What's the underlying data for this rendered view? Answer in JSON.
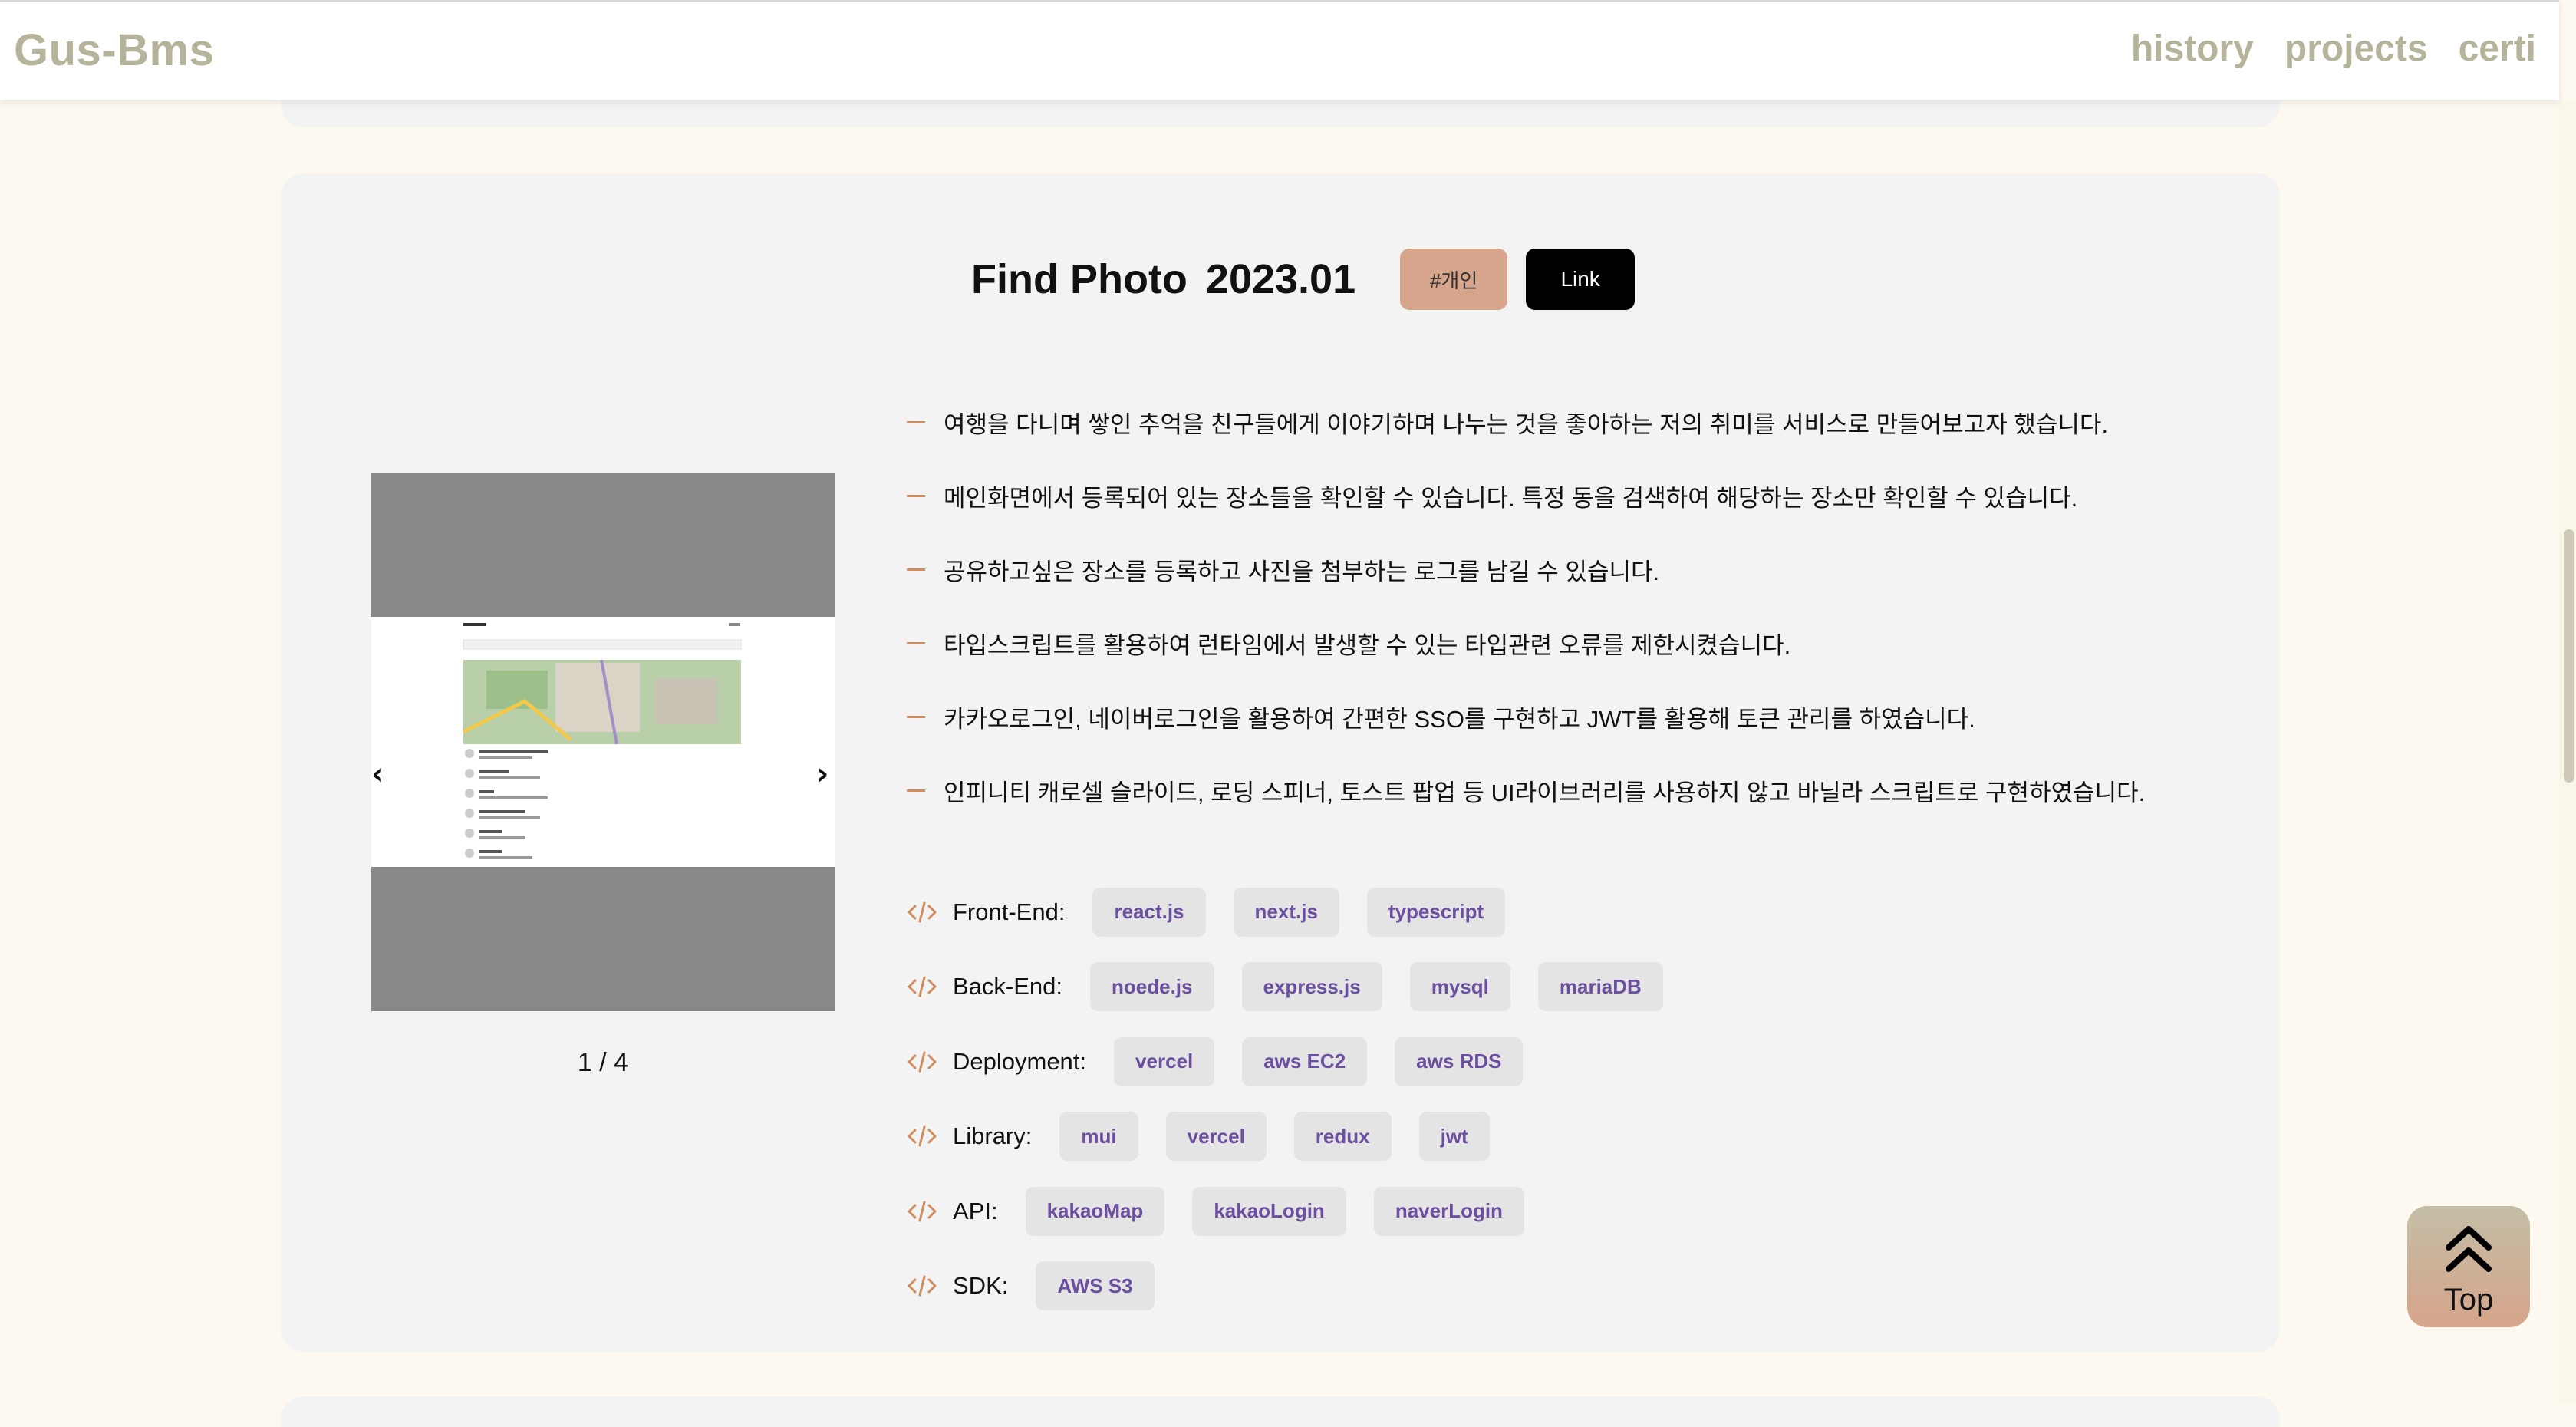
{
  "header": {
    "logo": "Gus-Bms",
    "nav": [
      "history",
      "projects",
      "certi"
    ]
  },
  "project": {
    "title": "Find Photo",
    "date": "2023.01",
    "tag": "#개인",
    "link_label": "Link",
    "carousel": {
      "counter": "1 / 4",
      "prev_arrow": "‹",
      "next_arrow": "›"
    },
    "descriptions": [
      "여행을 다니며 쌓인 추억을 친구들에게 이야기하며 나누는 것을 좋아하는 저의 취미를 서비스로 만들어보고자 했습니다.",
      "메인화면에서 등록되어 있는 장소들을 확인할 수 있습니다. 특정 동을 검색하여 해당하는 장소만 확인할 수 있습니다.",
      "공유하고싶은 장소를 등록하고 사진을 첨부하는 로그를 남길 수 있습니다.",
      "타입스크립트를 활용하여 런타임에서 발생할 수 있는 타입관련 오류를 제한시켰습니다.",
      "카카오로그인, 네이버로그인을 활용하여 간편한 SSO를 구현하고 JWT를 활용해 토큰 관리를 하였습니다.",
      "인피니티 캐로셀 슬라이드, 로딩 스피너, 토스트 팝업 등 UI라이브러리를 사용하지 않고 바닐라 스크립트로 구현하였습니다."
    ],
    "stacks": [
      {
        "label": "Front-End:",
        "items": [
          "react.js",
          "next.js",
          "typescript"
        ]
      },
      {
        "label": "Back-End:",
        "items": [
          "noede.js",
          "express.js",
          "mysql",
          "mariaDB"
        ]
      },
      {
        "label": "Deployment:",
        "items": [
          "vercel",
          "aws EC2",
          "aws RDS"
        ]
      },
      {
        "label": "Library:",
        "items": [
          "mui",
          "vercel",
          "redux",
          "jwt"
        ]
      },
      {
        "label": "API:",
        "items": [
          "kakaoMap",
          "kakaoLogin",
          "naverLogin"
        ]
      },
      {
        "label": "SDK:",
        "items": [
          "AWS S3"
        ]
      }
    ]
  },
  "top_button": {
    "label": "Top"
  },
  "colors": {
    "page_bg": "#fdf9f0",
    "card_bg": "#f3f3f3",
    "logo": "#b5b39a",
    "accent": "#d08c5c",
    "tag_bg": "#d6a58b",
    "chip_text": "#6b4fa0"
  }
}
